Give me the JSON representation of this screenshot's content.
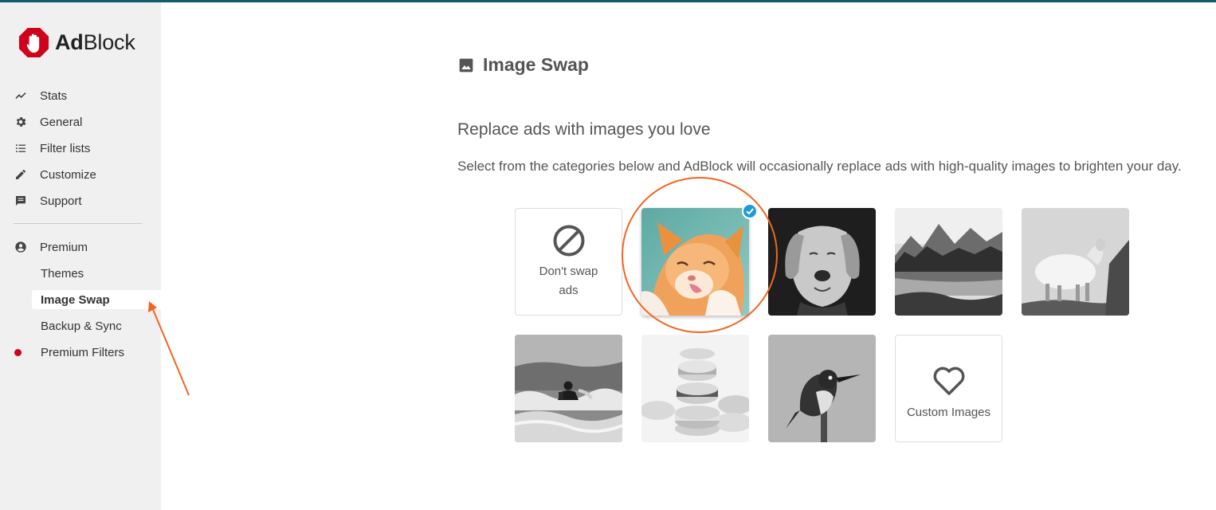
{
  "brand": {
    "name_bold": "Ad",
    "name_rest": "Block"
  },
  "nav": {
    "items": [
      {
        "label": "Stats",
        "icon": "trend-line-icon"
      },
      {
        "label": "General",
        "icon": "gear-icon"
      },
      {
        "label": "Filter lists",
        "icon": "list-icon"
      },
      {
        "label": "Customize",
        "icon": "pencil-icon"
      },
      {
        "label": "Support",
        "icon": "chat-icon"
      }
    ],
    "premium": {
      "label": "Premium",
      "icon": "account-circle-icon"
    },
    "premium_sub": [
      {
        "label": "Themes"
      },
      {
        "label": "Image Swap",
        "active": true
      },
      {
        "label": "Backup & Sync"
      },
      {
        "label": "Premium Filters",
        "badge": "red-dot"
      }
    ]
  },
  "page": {
    "title": "Image Swap",
    "subtitle": "Replace ads with images you love",
    "description": "Select from the categories below and AdBlock will occasionally replace ads with high-quality images to brighten your day."
  },
  "tiles": {
    "dont_swap": {
      "label": "Don't swap ads",
      "icon": "prohibited-icon"
    },
    "cat": {
      "selected": true,
      "icon": "check-circle-icon"
    },
    "dog": {},
    "landscape": {},
    "sheep": {},
    "surfer": {},
    "macarons": {},
    "bird": {},
    "custom": {
      "label": "Custom Images",
      "icon": "heart-outline-icon"
    }
  },
  "colors": {
    "topbar": "#0f5e6e",
    "sidebar_bg": "#f0f0f0",
    "accent_red": "#d0021b",
    "check_blue": "#1e9bd7",
    "annotation_orange": "#f26522"
  }
}
